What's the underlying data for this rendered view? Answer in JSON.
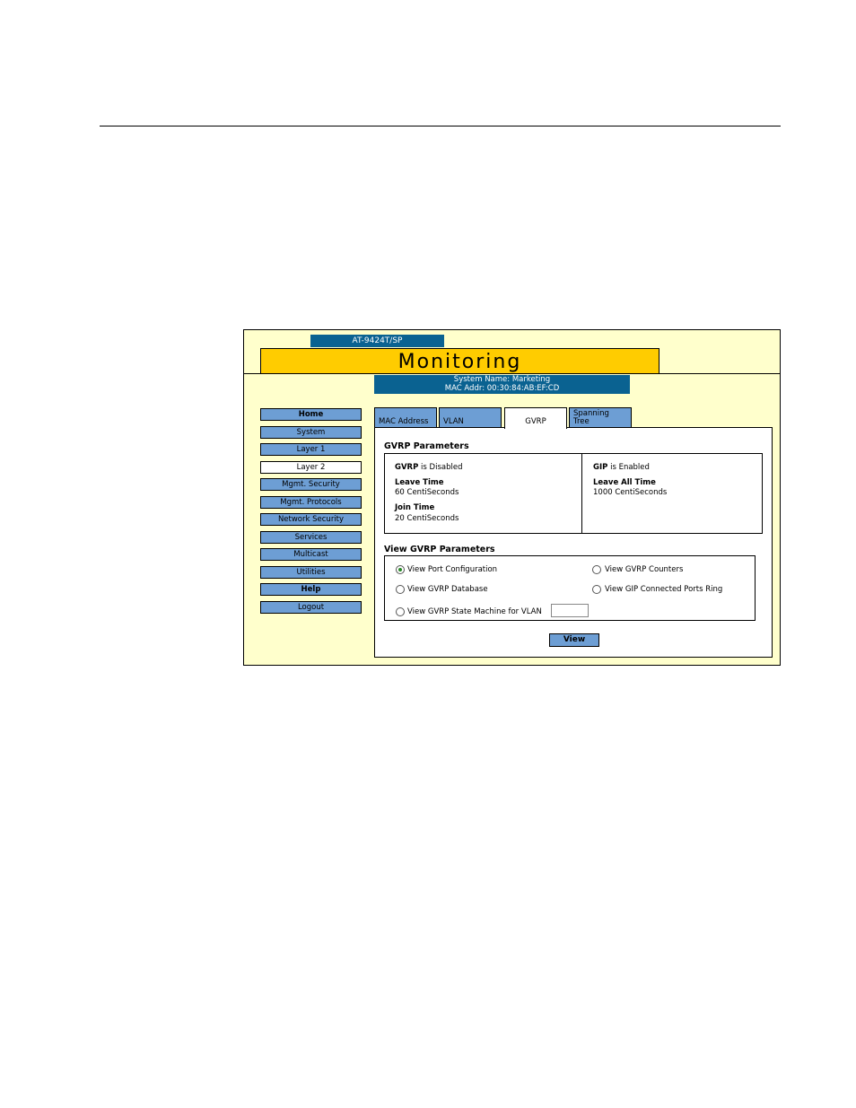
{
  "header": {
    "model": "AT-9424T/SP",
    "title": "Monitoring",
    "system_name": "System Name: Marketing",
    "mac_addr": "MAC Addr: 00:30:84:AB:EF:CD"
  },
  "nav": {
    "items": [
      {
        "label": "Home"
      },
      {
        "label": "System"
      },
      {
        "label": "Layer 1"
      },
      {
        "label": "Layer 2"
      },
      {
        "label": "Mgmt. Security"
      },
      {
        "label": "Mgmt. Protocols"
      },
      {
        "label": "Network Security"
      },
      {
        "label": "Services"
      },
      {
        "label": "Multicast"
      },
      {
        "label": "Utilities"
      },
      {
        "label": "Help"
      },
      {
        "label": "Logout"
      }
    ],
    "active": "Layer 2"
  },
  "tabs": {
    "items": [
      {
        "label": "MAC Address"
      },
      {
        "label": "VLAN"
      },
      {
        "label": "GVRP"
      },
      {
        "label": "Spanning",
        "label2": "Tree"
      }
    ],
    "selected": "GVRP"
  },
  "gvrp_params": {
    "title": "GVRP Parameters",
    "gvrp_label": "GVRP",
    "gvrp_status": " is Disabled",
    "leave_time_label": "Leave Time",
    "leave_time_value": "60 CentiSeconds",
    "join_time_label": "Join Time",
    "join_time_value": "20 CentiSeconds",
    "gip_label": "GIP",
    "gip_status": " is Enabled",
    "leave_all_label": "Leave All Time",
    "leave_all_value": "1000 CentiSeconds"
  },
  "view_params": {
    "title": "View GVRP Parameters",
    "options": [
      {
        "label": "View Port Configuration",
        "selected": true
      },
      {
        "label": "View GVRP Counters",
        "selected": false
      },
      {
        "label": "View GVRP Database",
        "selected": false
      },
      {
        "label": "View GIP Connected Ports Ring",
        "selected": false
      },
      {
        "label": "View GVRP State Machine for VLAN",
        "selected": false
      }
    ],
    "vlan_value": "",
    "view_button": "View"
  }
}
